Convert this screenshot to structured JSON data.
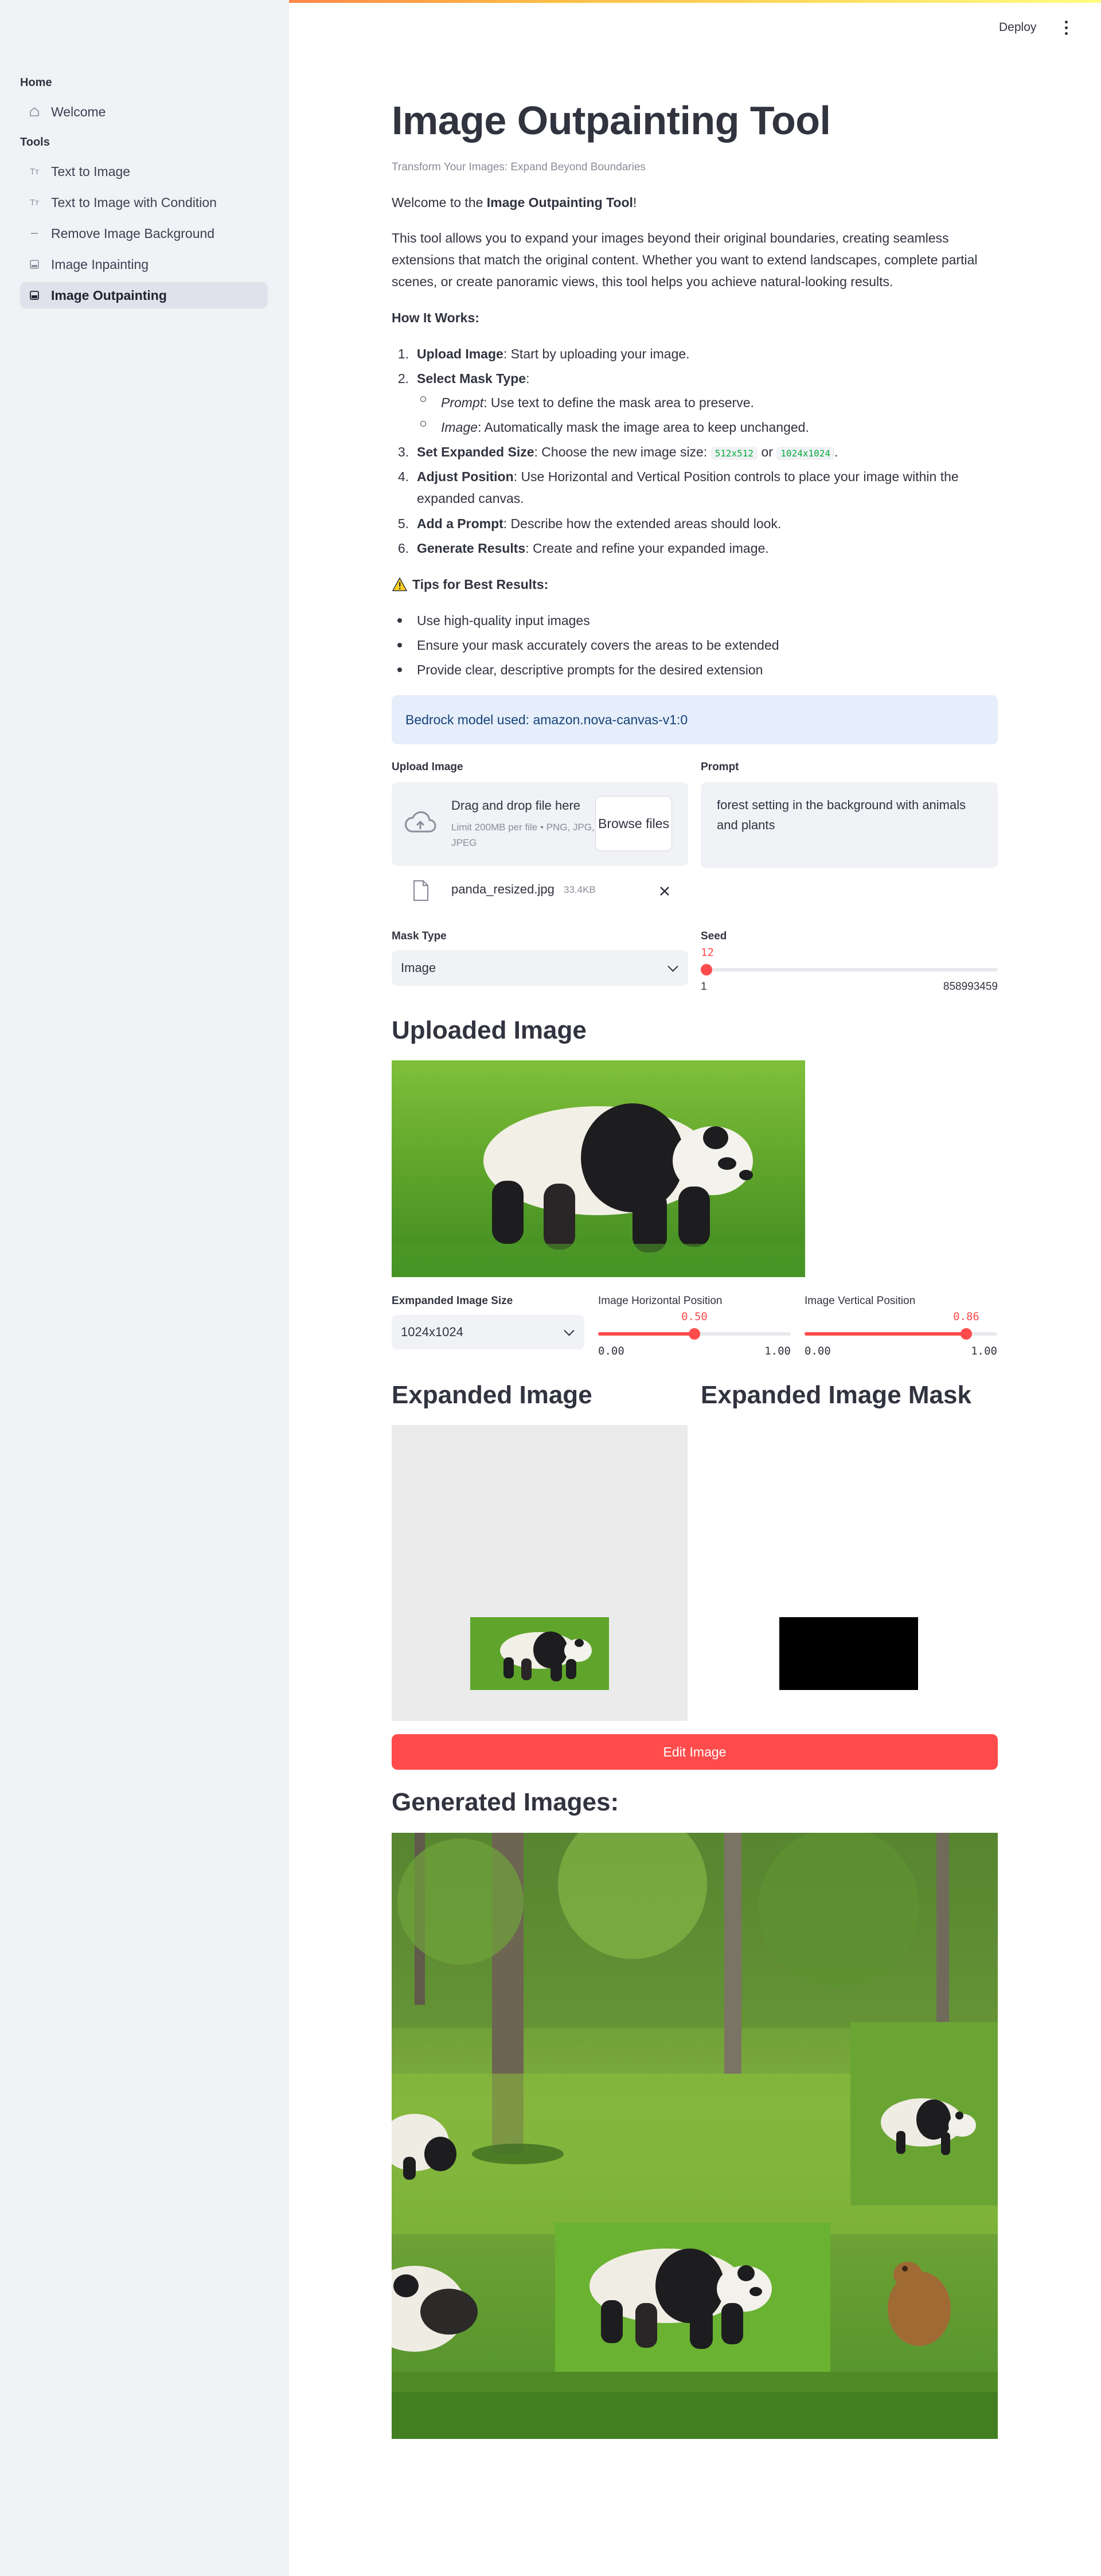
{
  "sidebar": {
    "sections": [
      {
        "title": "Home",
        "items": [
          {
            "label": "Welcome",
            "icon": "home-icon"
          }
        ]
      },
      {
        "title": "Tools",
        "items": [
          {
            "label": "Text to Image",
            "icon": "text-tt-icon"
          },
          {
            "label": "Text to Image with Condition",
            "icon": "text-tt-icon"
          },
          {
            "label": "Remove Image Background",
            "icon": "dash-icon"
          },
          {
            "label": "Image Inpainting",
            "icon": "image-frame-icon"
          },
          {
            "label": "Image Outpainting",
            "icon": "image-frame-icon",
            "active": true
          }
        ]
      }
    ]
  },
  "header": {
    "deploy": "Deploy"
  },
  "page": {
    "title": "Image Outpainting Tool",
    "caption": "Transform Your Images: Expand Beyond Boundaries",
    "welcome_prefix": "Welcome to the ",
    "welcome_bold": "Image Outpainting Tool",
    "welcome_suffix": "!",
    "intro": "This tool allows you to expand your images beyond their original boundaries, creating seamless extensions that match the original content. Whether you want to extend landscapes, complete partial scenes, or create panoramic views, this tool helps you achieve natural-looking results.",
    "how_title": "How It Works:",
    "steps": [
      {
        "num": "1.",
        "bold": "Upload Image",
        "text": ": Start by uploading your image."
      },
      {
        "num": "2.",
        "bold": "Select Mask Type",
        "text": ":"
      },
      {
        "num": "3.",
        "bold": "Set Expanded Size",
        "text": ": Choose the new image size:",
        "code1": "512x512",
        "or": "or",
        "code2": "1024x1024",
        "end": "."
      },
      {
        "num": "4.",
        "bold": "Adjust Position",
        "text": ": Use Horizontal and Vertical Position controls to place your image within the",
        "text2": "expanded canvas."
      },
      {
        "num": "5.",
        "bold": "Add a Prompt",
        "text": ": Describe how the extended areas should look."
      },
      {
        "num": "6.",
        "bold": "Generate Results",
        "text": ": Create and refine your expanded image."
      }
    ],
    "substeps": [
      {
        "italic": "Prompt",
        "text": ": Use text to define the mask area to preserve."
      },
      {
        "italic": "Image",
        "text": ": Automatically mask the image area to keep unchanged."
      }
    ],
    "tips_title": "Tips for Best Results:",
    "tips": [
      "Use high-quality input images",
      "Ensure your mask accurately covers the areas to be extended",
      "Provide clear, descriptive prompts for the desired extension"
    ],
    "model_info": "Bedrock model used: amazon.nova-canvas-v1:0"
  },
  "upload": {
    "label": "Upload Image",
    "drop_text": "Drag and drop file here",
    "limit_text": "Limit 200MB per file • PNG, JPG, JPEG",
    "browse": "Browse files",
    "file_name": "panda_resized.jpg",
    "file_size": "33.4KB"
  },
  "prompt": {
    "label": "Prompt",
    "value": "forest setting in the background with animals and plants"
  },
  "mask_type": {
    "label": "Mask Type",
    "value": "Image"
  },
  "seed": {
    "label": "Seed",
    "value": 12,
    "value_text": "12",
    "min": "1",
    "max": "858993459",
    "fraction": 0.0
  },
  "uploaded": {
    "heading": "Uploaded Image"
  },
  "expand": {
    "size_label": "Exmpanded Image Size",
    "size_value": "1024x1024",
    "horizontal": {
      "label": "Image Horizontal Position",
      "value_text": "0.50",
      "fraction": 0.5,
      "min": "0.00",
      "max": "1.00"
    },
    "vertical": {
      "label": "Image Vertical Position",
      "value_text": "0.86",
      "fraction": 0.86,
      "min": "0.00",
      "max": "1.00"
    }
  },
  "expanded_heading": "Expanded Image",
  "mask_heading": "Expanded Image Mask",
  "edit_button": "Edit Image",
  "generated_heading": "Generated Images:",
  "colors": {
    "accent": "#ff4b4b",
    "sidebar": "#f0f2f6",
    "info_bg": "#e5eefa",
    "info_text": "#17427a",
    "code": "#09ab3b"
  }
}
